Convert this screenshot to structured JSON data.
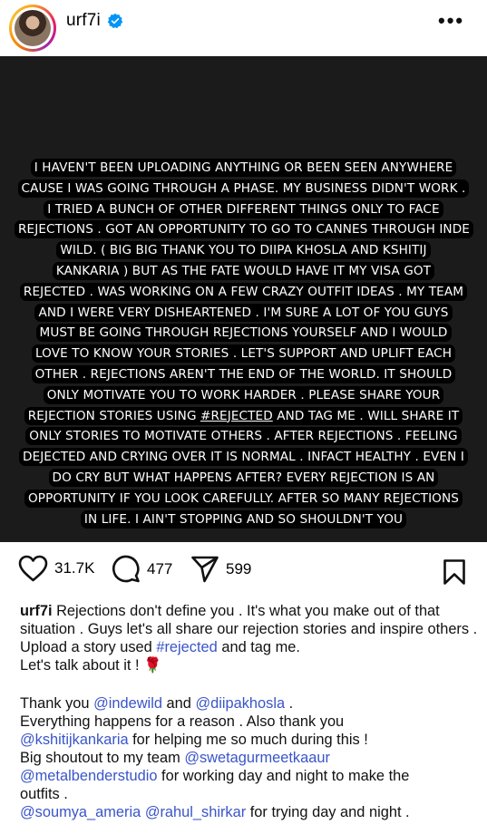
{
  "header": {
    "username": "urf7i",
    "more_label": "•••"
  },
  "post": {
    "story_lines": [
      "I HAVEN'T BEEN UPLOADING ANYTHING OR BEEN SEEN ANYWHERE",
      "CAUSE I WAS GOING THROUGH A PHASE. MY BUSINESS DIDN'T WORK .",
      "I TRIED A BUNCH OF OTHER DIFFERENT THINGS ONLY TO FACE",
      "REJECTIONS . GOT AN OPPORTUNITY TO GO TO CANNES THROUGH INDE",
      "WILD. ( BIG BIG THANK YOU TO DIIPA KHOSLA  AND KSHITIJ",
      "KANKARIA ) BUT AS THE FATE WOULD HAVE IT MY VISA GOT",
      "REJECTED . WAS WORKING ON A FEW CRAZY OUTFIT IDEAS . MY TEAM",
      "AND I WERE VERY DISHEARTENED . I'M SURE A LOT OF YOU GUYS",
      "MUST  BE GOING THROUGH REJECTIONS YOURSELF AND I WOULD",
      "LOVE TO KNOW YOUR STORIES . LET'S SUPPORT AND UPLIFT EACH",
      "OTHER . REJECTIONS AREN'T THE END OF THE WORLD. IT SHOULD",
      "ONLY MOTIVATE YOU TO WORK HARDER . PLEASE SHARE YOUR"
    ],
    "story_line_tag_before": "REJECTION STORIES USING ",
    "story_tag": "#REJECTED",
    "story_line_tag_after": " AND TAG ME . WILL SHARE IT",
    "story_lines_after": [
      "ONLY STORIES TO MOTIVATE OTHERS .  AFTER REJECTIONS . FEELING",
      "DEJECTED AND CRYING OVER IT IS NORMAL . INFACT HEALTHY . EVEN I",
      "DO CRY BUT WHAT HAPPENS AFTER? EVERY REJECTION IS AN",
      "OPPORTUNITY IF YOU LOOK CAREFULLY. AFTER SO MANY REJECTIONS",
      "IN LIFE. I AIN'T STOPPING AND SO SHOULDN'T YOU"
    ]
  },
  "actions": {
    "likes": "31.7K",
    "comments": "477",
    "shares": "599"
  },
  "caption": {
    "username": "urf7i",
    "text1": " Rejections don't define you . It's what you make out of that situation . Guys let's all share our rejection stories and inspire others . Upload a story used ",
    "hashtag": "#rejected",
    "text2": " and tag me.",
    "text3": "Let's talk about it ! ",
    "rose": "🌹",
    "thank_prefix": "Thank you ",
    "mention_indewild": "@indewild",
    "and_word": " and ",
    "mention_diipa": "@diipakhosla",
    "period": " .",
    "line_reason": "Everything happens for a reason . Also thank you",
    "mention_kshitij": "@kshitijkankaria",
    "kshitij_rest": " for helping me so much during this !",
    "shoutout_prefix": "Big shoutout to my team ",
    "mention_sweta": "@swetagurmeetkaaur",
    "mention_metal": "@metalbenderstudio",
    "metal_rest": " for working day and night to make the",
    "outfits": "outfits .",
    "mention_soumya": "@soumya_ameria",
    "space": " ",
    "mention_rahul": "@rahul_shirkar",
    "rahul_rest": " for trying day and night ."
  },
  "colors": {
    "link": "#3a55c9",
    "verified": "#0095f6",
    "image_bg": "#1b1b1b"
  },
  "icons": [
    "heart-icon",
    "comment-icon",
    "share-icon",
    "bookmark-icon",
    "verified-icon",
    "more-icon"
  ]
}
